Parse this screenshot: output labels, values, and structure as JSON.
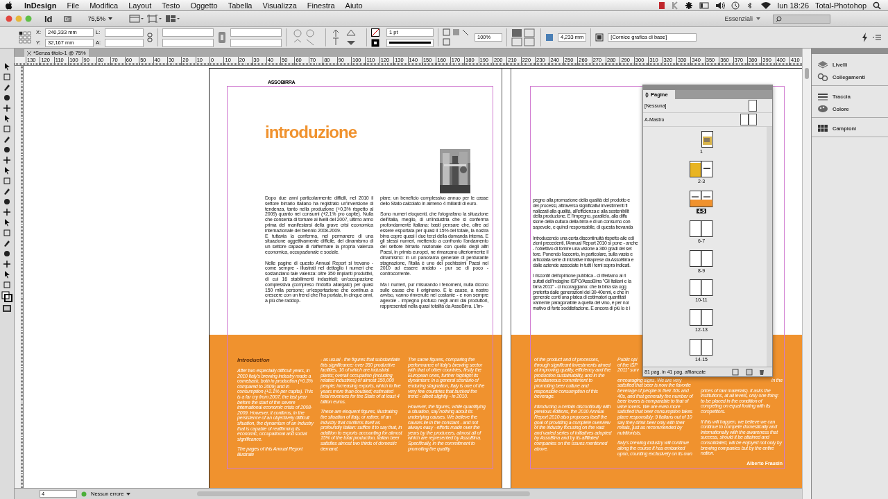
{
  "menubar": {
    "app": "InDesign",
    "menus": [
      "File",
      "Modifica",
      "Layout",
      "Testo",
      "Oggetto",
      "Tabella",
      "Visualizza",
      "Finestra",
      "Aiuto"
    ],
    "clock": "lun 18:26",
    "user": "Total-Photohop"
  },
  "app_bar": {
    "logo": "Id",
    "bridge": "Br",
    "zoom": "75,5%",
    "workspace": "Essenziali"
  },
  "control_panel": {
    "x_label": "X:",
    "x": "240,333 mm",
    "y_label": "Y:",
    "y": "32,167 mm",
    "w_label": "L:",
    "h_label": "A:",
    "stroke_weight": "1 pt",
    "scale": "100%",
    "offset": "4,233 mm",
    "object_style": "[Cornice grafica di base]"
  },
  "document_tab": {
    "title": "*Senza titolo-1 @ 75%"
  },
  "ruler": [
    "130",
    "120",
    "110",
    "100",
    "90",
    "80",
    "70",
    "60",
    "50",
    "40",
    "30",
    "20",
    "10",
    "0",
    "10",
    "20",
    "30",
    "40",
    "50",
    "60",
    "70",
    "80",
    "90",
    "100",
    "110",
    "120",
    "130",
    "140",
    "150",
    "160",
    "170",
    "180",
    "190",
    "200",
    "210",
    "220",
    "230",
    "240",
    "250",
    "260",
    "270",
    "280",
    "290",
    "300",
    "310",
    "320",
    "330",
    "340",
    "350",
    "360",
    "370",
    "380",
    "390",
    "400",
    "410"
  ],
  "spread": {
    "header": "ASSOBIRRA",
    "title": "introduzione",
    "image": {
      "kind": "picture"
    },
    "left_columns": [
      [
        [
          "Dopo due anni particolarmente difficili, nel 2010 il settore birrario italiano ha registrato un'inversione di tendenza, tanto nella produzione (+0,3% rispetto al 2009) quanto nei consumi (+2,1% pro capite). Nulla che consenta di tornare ai livelli del 2007, ultimo anno prima del manifestarsi della grave crisi economica internazionale del biennio 2008-2009.",
          "E tuttavia la conferma, nel permanere di una situazione oggettivamente difficile, del dinamismo di un settore capace di riaffermare la propria valenza economica, occupazionale e sociale."
        ],
        [
          "Nelle pagine di questo Annual Report si trovano - come sempre - illustrati nel dettaglio i numeri che sostanziano tale valenza: oltre 350 impianti produttivi, di cui 16 stabilimenti industriali; un'occupazione complessiva (compreso l'indotto allargato) per quasi 150 mila persone; un'esportazione che continua a crescere con un trend che l'ha portata, in cinque anni, a più che raddop-"
        ]
      ],
      [
        [
          "piare; un beneficio complessivo annuo per le casse dello Stato calcolato in almeno 4 miliardi di euro."
        ],
        [
          "Sono numeri eloquenti, che fotografano la situazione dell'Italia, meglio, di un'industria che si conferma profondamente italiana: basti pensare che, oltre ad essere esportata per quasi il 15% del totale, la nostra birra copre quasi i due terzi della domanda interna. E gli stessi numeri, mettendo a confronto l'andamento del settore birrario nazionale con quello degli altri Paesi, in primis europei, ne rimarcano ulteriormente il dinamismo: in un panorama generale di perdurante stagnazione, l'Italia è uno dei pochissimi Paesi nel 2010 ad essere andato - pur se di poco - controcorrente."
        ],
        [
          "Ma i numeri, pur misurando i fenomeni, nulla dicono sulle cause che li originano. E le cause, a nostro avviso, vanno rinvenute nel costante - e non sempre agevole - impegno profuso negli anni dai produttori, rappresentati nella quasi totalità da AssoBirra. L'im-"
        ]
      ]
    ],
    "right_column_paragraphs": [
      [
        "pegno alla promozione della qualità del prodotto e",
        "dei processi, attraverso significativi investimenti fi",
        "nalizzati alla qualità, all'efficienza e alla sostenibilit",
        "della produzione. E l'impegno, parallelo, alla diffu",
        "sione della cultura della birra e di un consumo con",
        "sapevole, e quindi responsabile, di questa bevanda"
      ],
      [
        "Introducendo una certa discontinuità rispetto alle edi",
        "zioni precedenti, l'Annual Report 2010 si pone - anche",
        "- l'obiettivo di fornire una visione a 360 gradi del set",
        "tore. Ponendo l'accento, in particolare, sulla vasta e",
        "articolata serie di iniziative intraprese da AssoBirra e",
        "dalle aziende associate in tutti i temi sopra indicati."
      ],
      [
        "I riscontri dell'opinione pubblica - ci riferiamo ai ri",
        "sultati dell'indagine ISPO/AssoBirra \"Gli Italiani e la",
        "birra 2011\" - ci incoraggiano: che la birra sia ogg",
        "preferita dalle generazioni dei 30-40enni, e che in",
        "generale conti una platea di estimatori quantitati",
        "vamente paragonabile a quella del vino, è per noi",
        "motivo di forte soddisfazione. E ancora di più lo è i"
      ]
    ],
    "english_heading": "Introduction",
    "english_left": [
      [
        "After two especially difficult years, in 2010 Italy's brewing industry made a comeback, both in production (+0.3% compared to 2009) and in consumption (+2.1% per capita). This is a far cry from 2007, the last year before the start of the severe international economic crisis of 2008-2009. However, it confirms, in the persistence of an objectively difficult situation, the dynamism of an industry that is capable of reaffirming its economic, occupational and social significance.",
        "The pages of this Annual Report illustrate"
      ],
      [
        "- as usual - the figures that substantiate this significance: over 350 productive facilities, 16 of which are industrial plants; overall occupation (including related industries) of almost 150,000 people; increasing exports, which in five years more than doubled; estimated total revenues for the State of at least 4 billion euros.",
        "These are eloquent figures, illustrating the situation of Italy, or rather, of an industry that confirms itself as profoundly Italian: suffice it to say that, in addition to exports accounting for almost 15% of the total production, Italian beer satisfies almost two thirds of domestic demand."
      ],
      [
        "The same figures, comparing the performance of Italy's brewing sector with that of other countries, firstly the European ones, further highlight its dynamism: in a general scenario of enduring stagnation, Italy is one of the very few countries that bucked the trend - albeit slightly - in 2010.",
        "However, the figures, while quantifying a situation, say nothing about its underlying causes. We believe the causes lie in the constant - and not always easy - efforts made over the years by the producers, almost all of which are represented by AssoBirra. Specifically, in the commitment to promoting the quality"
      ]
    ],
    "english_right_col1": [
      "of the product and of processes, through significant investments aimed at improving quality, efficiency and the production sustainability, and in the simultaneous commitment to promoting beer culture and responsible consumption of this beverage.",
      "Introducing a certain discontinuity with previous editions, the 2010 Annual Report 2010 also proposes itself the goal of providing a complete overview of the industry focusing on the vast and varied series of initiatives adopted by AssoBirra and by its affiliated companies on the issues mentioned above."
    ],
    "english_right_col2_cut": [
      "Public opi",
      "of the ISP",
      "2011\" surv"
    ],
    "english_right_col2": [
      "encouraging signs. We are very satisfied that beer is now the favorite beverage of people in their 30s and 40s, and that generally the number of beer lovers is comparable to that of wine lovers. We are even more satisfied that beer consumption takes place responsibly: 9 Italians out of 10 say they drink beer only with their meals, just as recommended by nutritionists.",
      "Italy's brewing industry will continue along the course it has embarked upon, counting exclusively on its own"
    ],
    "english_right_col3_cut": "in the",
    "english_right_col3": [
      "prices of raw materials). It asks the institutions, at all levels, only one thing: to be placed in the condition of competing on equal footing with its competitors.",
      "If this will happen, we believe we can continue to compete domestically and internationally with the awareness that success, should it be attained and consolidated, will be enjoyed not only by brewing companies but by the entire nation."
    ],
    "signature": "Alberto Frausin"
  },
  "pages_panel": {
    "title": "Pagine",
    "masters": [
      {
        "name": "[Nessuna]",
        "kind": "single"
      },
      {
        "name": "A-Mastro",
        "kind": "spread"
      }
    ],
    "pages": [
      {
        "label": "1",
        "kind": "single-photo",
        "selected": false
      },
      {
        "label": "2-3",
        "kind": "spread-photo",
        "selected": false
      },
      {
        "label": "4-5",
        "kind": "spread-orange",
        "selected": true
      },
      {
        "label": "6-7",
        "kind": "spread-blank",
        "selected": false
      },
      {
        "label": "8-9",
        "kind": "spread-blank",
        "selected": false
      },
      {
        "label": "10-11",
        "kind": "spread-blank",
        "selected": false
      },
      {
        "label": "12-13",
        "kind": "spread-blank",
        "selected": false
      },
      {
        "label": "14-15",
        "kind": "spread-blank",
        "selected": false
      }
    ],
    "footer": "81 pag. in 41 pag. affiancate"
  },
  "dock": [
    [
      {
        "label": "Livelli",
        "kind": "layers"
      },
      {
        "label": "Collegamenti",
        "kind": "links"
      }
    ],
    [
      {
        "label": "Traccia",
        "kind": "stroke"
      },
      {
        "label": "Colore",
        "kind": "color"
      }
    ],
    [
      {
        "label": "Campioni",
        "kind": "swatches"
      }
    ]
  ],
  "status_bar": {
    "page": "4",
    "preflight": "Nessun errore"
  }
}
